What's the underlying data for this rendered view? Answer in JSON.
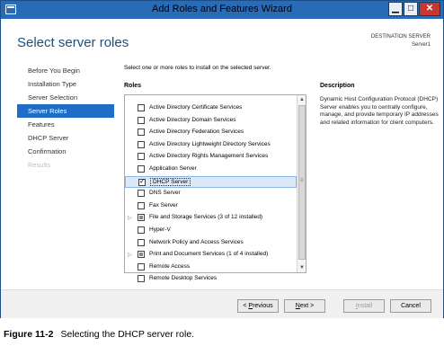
{
  "window": {
    "title": "Add Roles and Features Wizard",
    "minimize_glyph": "▁",
    "maximize_glyph": "□",
    "close_glyph": "✕"
  },
  "header": {
    "page_title": "Select server roles",
    "destination_label": "DESTINATION SERVER",
    "destination_server": "Server1"
  },
  "nav": {
    "items": [
      {
        "label": "Before You Begin",
        "state": "normal"
      },
      {
        "label": "Installation Type",
        "state": "normal"
      },
      {
        "label": "Server Selection",
        "state": "normal"
      },
      {
        "label": "Server Roles",
        "state": "active"
      },
      {
        "label": "Features",
        "state": "normal"
      },
      {
        "label": "DHCP Server",
        "state": "normal"
      },
      {
        "label": "Confirmation",
        "state": "normal"
      },
      {
        "label": "Results",
        "state": "disabled"
      }
    ]
  },
  "main": {
    "instruction": "Select one or more roles to install on the selected server.",
    "roles_heading": "Roles",
    "roles": [
      {
        "label": "Active Directory Certificate Services",
        "checked": false,
        "expandable": false
      },
      {
        "label": "Active Directory Domain Services",
        "checked": false,
        "expandable": false
      },
      {
        "label": "Active Directory Federation Services",
        "checked": false,
        "expandable": false
      },
      {
        "label": "Active Directory Lightweight Directory Services",
        "checked": false,
        "expandable": false
      },
      {
        "label": "Active Directory Rights Management Services",
        "checked": false,
        "expandable": false
      },
      {
        "label": "Application Server",
        "checked": false,
        "expandable": false
      },
      {
        "label": "DHCP Server",
        "checked": true,
        "expandable": false,
        "selected": true
      },
      {
        "label": "DNS Server",
        "checked": false,
        "expandable": false
      },
      {
        "label": "Fax Server",
        "checked": false,
        "expandable": false
      },
      {
        "label": "File and Storage Services (3 of 12 installed)",
        "checked": "partial",
        "expandable": true
      },
      {
        "label": "Hyper-V",
        "checked": false,
        "expandable": false
      },
      {
        "label": "Network Policy and Access Services",
        "checked": false,
        "expandable": false
      },
      {
        "label": "Print and Document Services (1 of 4 installed)",
        "checked": "partial",
        "expandable": true
      },
      {
        "label": "Remote Access",
        "checked": false,
        "expandable": false
      },
      {
        "label": "Remote Desktop Services",
        "checked": false,
        "expandable": false
      }
    ],
    "description_heading": "Description",
    "description_text": "Dynamic Host Configuration Protocol (DHCP) Server enables you to centrally configure, manage, and provide temporary IP addresses and related information for client computers."
  },
  "footer": {
    "previous_mnemonic": "P",
    "previous_rest": "revious",
    "previous_prefix": "< ",
    "next_mnemonic": "N",
    "next_rest": "ext >",
    "install_mnemonic": "I",
    "install_rest": "nstall",
    "cancel_label": "Cancel"
  },
  "caption": {
    "figure_label": "Figure 11-2",
    "figure_text": "Selecting the DHCP server role."
  },
  "colors": {
    "title_bar": "#2a6bb8",
    "nav_active": "#1e6ec8",
    "page_title": "#1e4e79",
    "close_button": "#c7372f"
  },
  "icons": {
    "checkbox_checked": "check-icon",
    "expander": "triangle-right-icon",
    "scroll_up": "chevron-up-icon",
    "scroll_down": "chevron-down-icon"
  }
}
